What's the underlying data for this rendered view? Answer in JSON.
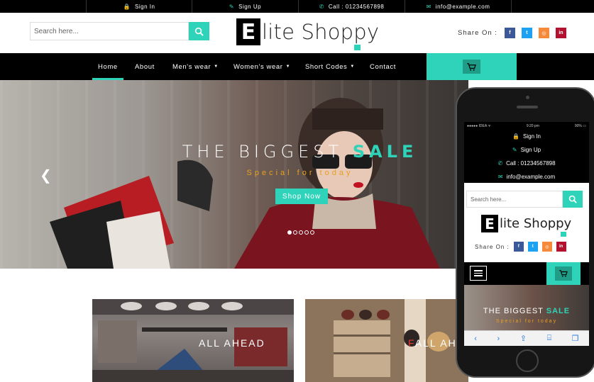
{
  "topbar": {
    "items": [
      {
        "icon": "lock-icon",
        "glyph": "🔒",
        "label": "Sign In"
      },
      {
        "icon": "edit-icon",
        "glyph": "✎",
        "label": "Sign Up"
      },
      {
        "icon": "phone-icon",
        "glyph": "✆",
        "label": "Call : 01234567898"
      },
      {
        "icon": "envelope-icon",
        "glyph": "✉",
        "label": "info@example.com"
      }
    ]
  },
  "header": {
    "search_placeholder": "Search here...",
    "logo_letter": "E",
    "logo_rest": "lite Shoppy",
    "share_label": "Share On :",
    "social": [
      {
        "name": "facebook",
        "glyph": "f",
        "color": "#3b5998"
      },
      {
        "name": "twitter",
        "glyph": "t",
        "color": "#1da1f2"
      },
      {
        "name": "instagram",
        "glyph": "◎",
        "color": "#f58a3a"
      },
      {
        "name": "linkedin",
        "glyph": "in",
        "color": "#b3122e"
      }
    ]
  },
  "nav": {
    "items": [
      {
        "label": "Home",
        "active": true
      },
      {
        "label": "About"
      },
      {
        "label": "Men's wear",
        "dropdown": true
      },
      {
        "label": "Women's wear",
        "dropdown": true
      },
      {
        "label": "Short Codes",
        "dropdown": true
      },
      {
        "label": "Contact"
      }
    ],
    "cart_icon": "cart-icon"
  },
  "hero": {
    "title_plain": "THE BIGGEST ",
    "title_highlight": "SALE",
    "subtitle": "Special for today",
    "button": "Shop Now",
    "slides": 5,
    "active_slide": 1
  },
  "categories": [
    {
      "label_first": "",
      "label_rest": "ALL AHEAD"
    },
    {
      "label_first": "F",
      "label_rest": "ALL AH"
    }
  ],
  "mobile": {
    "status_left": "●●●●● IDEA ᯤ",
    "status_time": "9:20 pm",
    "status_right": "90% ▭",
    "top_items": [
      {
        "glyph": "🔒",
        "label": "Sign In"
      },
      {
        "glyph": "✎",
        "label": "Sign Up"
      },
      {
        "glyph": "✆",
        "label": "Call : 01234567898"
      },
      {
        "glyph": "✉",
        "label": "info@example.com"
      }
    ],
    "search_placeholder": "Search here...",
    "logo_letter": "E",
    "logo_rest": "lite Shoppy",
    "share_label": "Share On :",
    "hero_title_plain": "THE BIGGEST ",
    "hero_title_highlight": "SALE",
    "hero_subtitle": "Special for today"
  },
  "colors": {
    "accent": "#2fd3b9",
    "topbar_bg": "#000000",
    "subtitle": "#e8a020"
  }
}
